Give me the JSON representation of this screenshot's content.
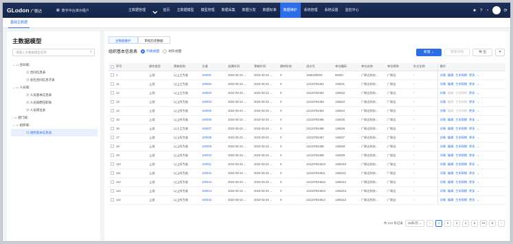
{
  "topbar": {
    "logo": "GLodon",
    "logo_cn": "广联达",
    "switcher": "数字中台演示租户",
    "nav": [
      "主数据管理",
      "首页",
      "主数据模型",
      "模型管理",
      "数据采集",
      "数据分发",
      "数据标准",
      "数据维护",
      "系统管理",
      "系统设置",
      "监控中心"
    ],
    "active_nav": 7
  },
  "subtabs": {
    "active": "基础主数据"
  },
  "sidebar": {
    "title": "主数据模型",
    "search_placeholder": "请输入主数据模型名称",
    "tree": [
      {
        "label": "合同域：",
        "level": 0,
        "type": "folder"
      },
      {
        "label": "合同信息表",
        "level": 1,
        "type": "table"
      },
      {
        "label": "总包合同信息子表",
        "level": 1,
        "type": "table"
      },
      {
        "label": "人员域：",
        "level": 0,
        "type": "folder"
      },
      {
        "label": "人员基本信息表",
        "level": 1,
        "type": "table"
      },
      {
        "label": "人员就聘任职表",
        "level": 1,
        "type": "table"
      },
      {
        "label": "人员岗位表",
        "level": 1,
        "type": "table"
      },
      {
        "label": "部门域：",
        "level": 0,
        "type": "folder",
        "collapsed": true
      },
      {
        "label": "组织域：",
        "level": 0,
        "type": "folder"
      },
      {
        "label": "组织基本信息表",
        "level": 1,
        "type": "table",
        "selected": true
      }
    ]
  },
  "main": {
    "tabs": [
      "主数据维护",
      "审批历史数据"
    ],
    "title": "组织基本信息表",
    "radio_list": "列表视图",
    "radio_tree": "树形视图",
    "btn_new": "新建",
    "btn_batch": "更新归档",
    "btn_export": "导 出",
    "columns": [
      "序号",
      "操作类型",
      "更新机构",
      "主键",
      "创建时间",
      "更新时间",
      "删除状态",
      "流水号",
      "单位编码",
      "单位名称",
      "单位简称",
      "外文全称",
      "操作"
    ],
    "rows": [
      [
        "1",
        "上游",
        "以上工为准",
        "100001",
        "2022-03-23 ...",
        "2022-03-23 ...",
        "0",
        "1559100003",
        "68263",
        "广联达科技...",
        "广联达",
        "-"
      ],
      [
        "11",
        "上游",
        "以上工为准",
        "100002",
        "2022-03-23 ...",
        "2022-03-23 ...",
        "0",
        "14133754461",
        "148421",
        "广联达科技...",
        "广联达",
        "-"
      ],
      [
        "12",
        "上游",
        "以上工为准",
        "100003",
        "2022-03-23 ...",
        "2022-03-23 ...",
        "0",
        "14133754462",
        "148422",
        "广联达科技...",
        "广联达",
        "-"
      ],
      [
        "13",
        "上游",
        "以上所为准",
        "100004",
        "2022-03-23 ...",
        "2022-03-23 ...",
        "0",
        "14133754463",
        "148423",
        "广联达科技...",
        "广联达",
        "-"
      ],
      [
        "14",
        "上游",
        "以上所为准",
        "100005",
        "2022-03-23 ...",
        "2022-03-23 ...",
        "0",
        "14133754464",
        "148424",
        "广联达科技...",
        "广联达",
        "-"
      ],
      [
        "15",
        "上游",
        "以上所为准",
        "100006",
        "2022-03-23 ...",
        "2022-03-23 ...",
        "0",
        "14133754465",
        "148425",
        "广联达科技...",
        "广联达",
        "-"
      ],
      [
        "16",
        "上游",
        "以人工为准",
        "100007",
        "2022-03-23 ...",
        "2022-03-23 ...",
        "0",
        "14133754466",
        "148426",
        "广联达科技...",
        "广联达",
        "-"
      ],
      [
        "17",
        "上游",
        "以上所为准",
        "100008",
        "2022-03-23 ...",
        "2022-03-23 ...",
        "0",
        "14133754467",
        "148427",
        "广联达科技...",
        "广联达",
        "-"
      ],
      [
        "18",
        "上游",
        "以上所为准",
        "100009",
        "2022-03-23 ...",
        "2022-03-23 ...",
        "0",
        "14133754468",
        "148428",
        "广联达科技...",
        "广联达",
        "-"
      ],
      [
        "19",
        "上游",
        "以上所为准",
        "100010",
        "2022-03-23 ...",
        "2022-03-23 ...",
        "0",
        "14133754469",
        "148429",
        "广联达科技...",
        "广联达",
        "-"
      ],
      [
        "110",
        "上游",
        "以上所为准",
        "100011",
        "2022-03-23 ...",
        "2022-03-23 ...",
        "0",
        "141337544610",
        "1484210",
        "广联达科技...",
        "广联达",
        "-"
      ],
      [
        "111",
        "上游",
        "以上所为准",
        "100012",
        "2022-03-23 ...",
        "2022-03-23 ...",
        "0",
        "141337544611",
        "1484211",
        "广联达科技...",
        "广联达",
        "-"
      ],
      [
        "112",
        "上游",
        "以上所为准",
        "100013",
        "2022-03-23 ...",
        "2022-03-23 ...",
        "0",
        "141337544612",
        "1484212",
        "广联达科技...",
        "广联达",
        "-"
      ],
      [
        "113",
        "上游",
        "以上所为准",
        "100014",
        "2022-03-23 ...",
        "2022-03-23 ...",
        "0",
        "141337544613",
        "1484213",
        "广联达科技...",
        "广联达",
        "-"
      ],
      [
        "114",
        "上游",
        "以上所为准",
        "100015",
        "2022-03-23 ...",
        "2022-03-23 ...",
        "0",
        "141337544614",
        "1484214",
        "广联达科技...",
        "广联达",
        "-"
      ]
    ],
    "row_ops": [
      "详情",
      "编辑",
      "生命周期",
      "更多"
    ],
    "row_ops_enabled": [
      true,
      true,
      false,
      false,
      false,
      true,
      true,
      true,
      true,
      true,
      true,
      true,
      true,
      true,
      true
    ]
  },
  "pagination": {
    "total": "共 123 条记录",
    "page_size": "15条/页",
    "pages": [
      "1",
      "2",
      "3",
      "4",
      "5",
      "•••",
      "9"
    ],
    "current": "1"
  }
}
